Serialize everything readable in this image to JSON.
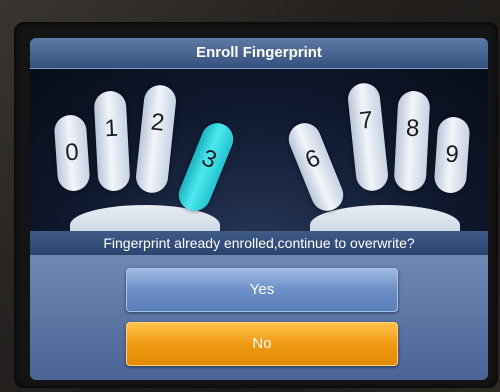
{
  "title": "Enroll Fingerprint",
  "fingers": [
    {
      "label": "0",
      "selected": false
    },
    {
      "label": "1",
      "selected": false
    },
    {
      "label": "2",
      "selected": false
    },
    {
      "label": "3",
      "selected": true
    },
    {
      "label": "6",
      "selected": false
    },
    {
      "label": "7",
      "selected": false
    },
    {
      "label": "8",
      "selected": false
    },
    {
      "label": "9",
      "selected": false
    }
  ],
  "prompt": "Fingerprint already enrolled,continue to overwrite?",
  "buttons": {
    "yes_label": "Yes",
    "no_label": "No"
  },
  "colors": {
    "title_bar": "#4a6794",
    "selected_finger": "#2fd6de",
    "yes_button": "#7a9ccf",
    "no_button": "#f5a623"
  }
}
